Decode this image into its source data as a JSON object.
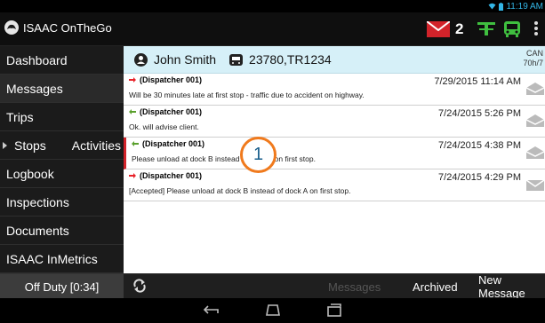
{
  "status_bar": {
    "time": "11:19 AM"
  },
  "app": {
    "title": "ISAAC OnTheGo",
    "unread_count": "2"
  },
  "sidebar": {
    "items": [
      {
        "label": "Dashboard"
      },
      {
        "label": "Messages"
      },
      {
        "label": "Trips"
      },
      {
        "label": "Stops"
      },
      {
        "label": "Activities"
      },
      {
        "label": "Logbook"
      },
      {
        "label": "Inspections"
      },
      {
        "label": "Documents"
      },
      {
        "label": "ISAAC InMetrics"
      }
    ]
  },
  "driver": {
    "name": "John Smith",
    "vehicle": "23780,TR1234",
    "cycle": "CAN",
    "hours": "70h/7"
  },
  "messages": [
    {
      "from": "(Dispatcher 001)",
      "body": "Will be 30 minutes late at first stop - traffic due to accident on highway.",
      "time": "7/29/2015 11:14 AM",
      "direction": "outgoing"
    },
    {
      "from": "(Dispatcher 001)",
      "body": "Ok. will advise client.",
      "time": "7/24/2015 5:26 PM",
      "direction": "incoming"
    },
    {
      "from": "(Dispatcher 001)",
      "body": "Please unload at dock B instead of dock A on first stop.",
      "time": "7/24/2015 4:38 PM",
      "direction": "incoming"
    },
    {
      "from": "(Dispatcher 001)",
      "body": "[Accepted] Please unload at dock B instead of dock A on first stop.",
      "time": "7/24/2015 4:29 PM",
      "direction": "outgoing"
    }
  ],
  "callout": {
    "number": "1"
  },
  "bottom_bar": {
    "duty_status": "Off Duty [0:34]",
    "tab_messages": "Messages",
    "tab_archived": "Archived",
    "tab_new": "New Message"
  },
  "colors": {
    "accent": "#33b5e5",
    "unread_badge": "#d2232a",
    "outgoing_arrow": "#e8232a",
    "incoming_arrow": "#5aa02c",
    "callout_ring": "#f07a1d"
  },
  "icons": [
    "wifi-icon",
    "battery-icon",
    "app-logo-icon",
    "mail-icon",
    "signal-tower-icon",
    "truck-icon",
    "overflow-menu-icon",
    "person-icon",
    "vehicle-icon",
    "envelope-icon",
    "refresh-icon",
    "back-icon",
    "home-icon",
    "recent-apps-icon"
  ]
}
